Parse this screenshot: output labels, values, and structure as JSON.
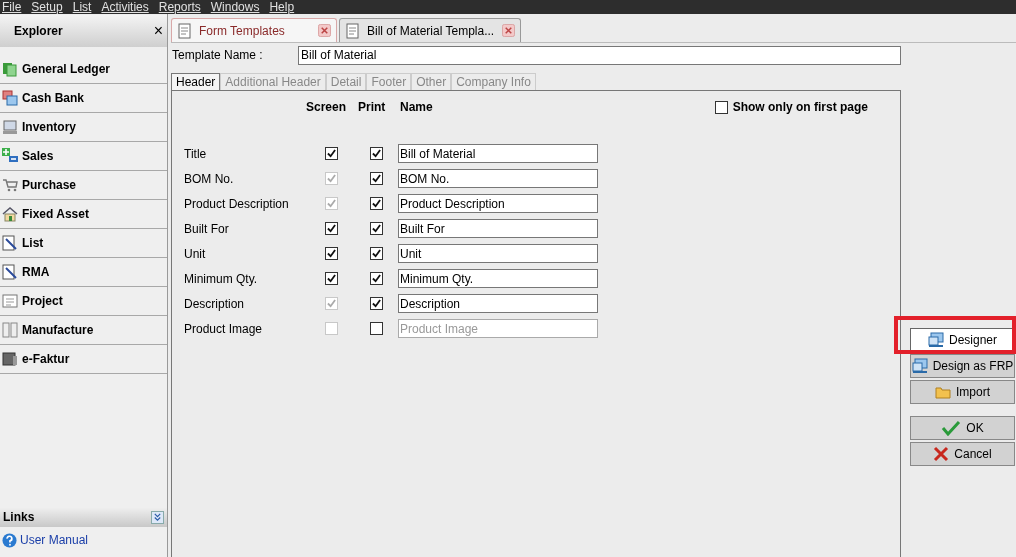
{
  "menu": [
    "File",
    "Setup",
    "List",
    "Activities",
    "Reports",
    "Windows",
    "Help"
  ],
  "explorer": {
    "title": "Explorer",
    "close": "×",
    "items": [
      {
        "label": "General Ledger",
        "kind": "ledger"
      },
      {
        "label": "Cash Bank",
        "kind": "cash"
      },
      {
        "label": "Inventory",
        "kind": "inventory"
      },
      {
        "label": "Sales",
        "kind": "sales"
      },
      {
        "label": "Purchase",
        "kind": "purchase"
      },
      {
        "label": "Fixed Asset",
        "kind": "asset"
      },
      {
        "label": "List",
        "kind": "list"
      },
      {
        "label": "RMA",
        "kind": "list"
      },
      {
        "label": "Project",
        "kind": "project"
      },
      {
        "label": "Manufacture",
        "kind": "manufacture"
      },
      {
        "label": "e-Faktur",
        "kind": "faktur"
      }
    ]
  },
  "links": {
    "title": "Links",
    "items": [
      "User Manual"
    ]
  },
  "doc_tabs": [
    {
      "label": "Form Templates",
      "selected": false
    },
    {
      "label": "Bill of Material Templa...",
      "selected": true
    }
  ],
  "template_name": {
    "label": "Template Name :",
    "value": "Bill of Material"
  },
  "section_tabs": [
    {
      "label": "Header",
      "selected": true
    },
    {
      "label": "Additional Header",
      "selected": false
    },
    {
      "label": "Detail",
      "selected": false
    },
    {
      "label": "Footer",
      "selected": false
    },
    {
      "label": "Other",
      "selected": false
    },
    {
      "label": "Company Info",
      "selected": false
    }
  ],
  "columns": [
    "Screen",
    "Print",
    "Name"
  ],
  "show_first_page": {
    "label": "Show only on first page",
    "checked": false
  },
  "fields": [
    {
      "label": "Title",
      "screen": true,
      "screen_disabled": false,
      "print": true,
      "name": "Bill of Material",
      "disabled": false
    },
    {
      "label": "BOM No.",
      "screen": true,
      "screen_disabled": true,
      "print": true,
      "name": "BOM No.",
      "disabled": false
    },
    {
      "label": "Product Description",
      "screen": true,
      "screen_disabled": true,
      "print": true,
      "name": "Product Description",
      "disabled": false
    },
    {
      "label": "Built For",
      "screen": true,
      "screen_disabled": false,
      "print": true,
      "name": "Built For",
      "disabled": false
    },
    {
      "label": "Unit",
      "screen": true,
      "screen_disabled": false,
      "print": true,
      "name": "Unit",
      "disabled": false
    },
    {
      "label": "Minimum Qty.",
      "screen": true,
      "screen_disabled": false,
      "print": true,
      "name": "Minimum Qty.",
      "disabled": false
    },
    {
      "label": "Description",
      "screen": true,
      "screen_disabled": true,
      "print": true,
      "name": "Description",
      "disabled": false
    },
    {
      "label": "Product Image",
      "screen": false,
      "screen_disabled": true,
      "print": false,
      "name": "Product Image",
      "disabled": true
    }
  ],
  "buttons": [
    {
      "label": "Designer",
      "kind": "designer",
      "highlighted": true
    },
    {
      "label": "Design as FRP",
      "kind": "designer",
      "highlighted": false
    },
    {
      "label": "Import",
      "kind": "import",
      "highlighted": false
    },
    {
      "label": "OK",
      "kind": "ok",
      "highlighted": false
    },
    {
      "label": "Cancel",
      "kind": "cancel",
      "highlighted": false
    }
  ]
}
